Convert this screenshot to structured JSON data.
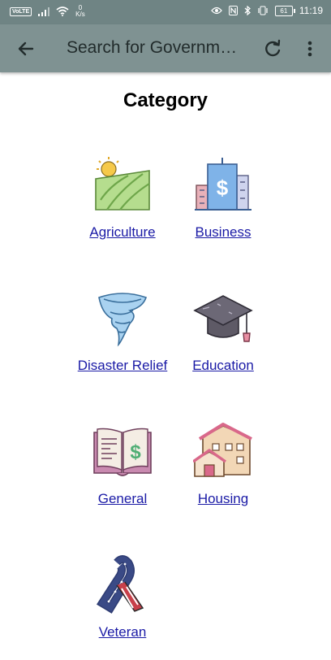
{
  "status_bar": {
    "network_badge": "VoLTE",
    "speed_value": "0",
    "speed_unit": "K/s",
    "battery": "61",
    "time": "11:19"
  },
  "app_bar": {
    "title": "Search for Governm…",
    "back_icon": "arrow-left-icon",
    "refresh_icon": "refresh-icon",
    "menu_icon": "more-vertical-icon"
  },
  "page": {
    "heading": "Category"
  },
  "categories": [
    {
      "label": "Agriculture",
      "icon": "field-sun-icon"
    },
    {
      "label": "Business",
      "icon": "office-building-icon"
    },
    {
      "label": "Disaster Relief",
      "icon": "tornado-icon"
    },
    {
      "label": "Education",
      "icon": "graduation-cap-icon"
    },
    {
      "label": "General",
      "icon": "book-dollar-icon"
    },
    {
      "label": "Housing",
      "icon": "houses-icon"
    },
    {
      "label": "Veteran",
      "icon": "awareness-ribbon-icon"
    }
  ],
  "colors": {
    "status_bar_bg": "#6f8484",
    "app_bar_bg": "#7f9292",
    "link": "#1a1aa6"
  }
}
